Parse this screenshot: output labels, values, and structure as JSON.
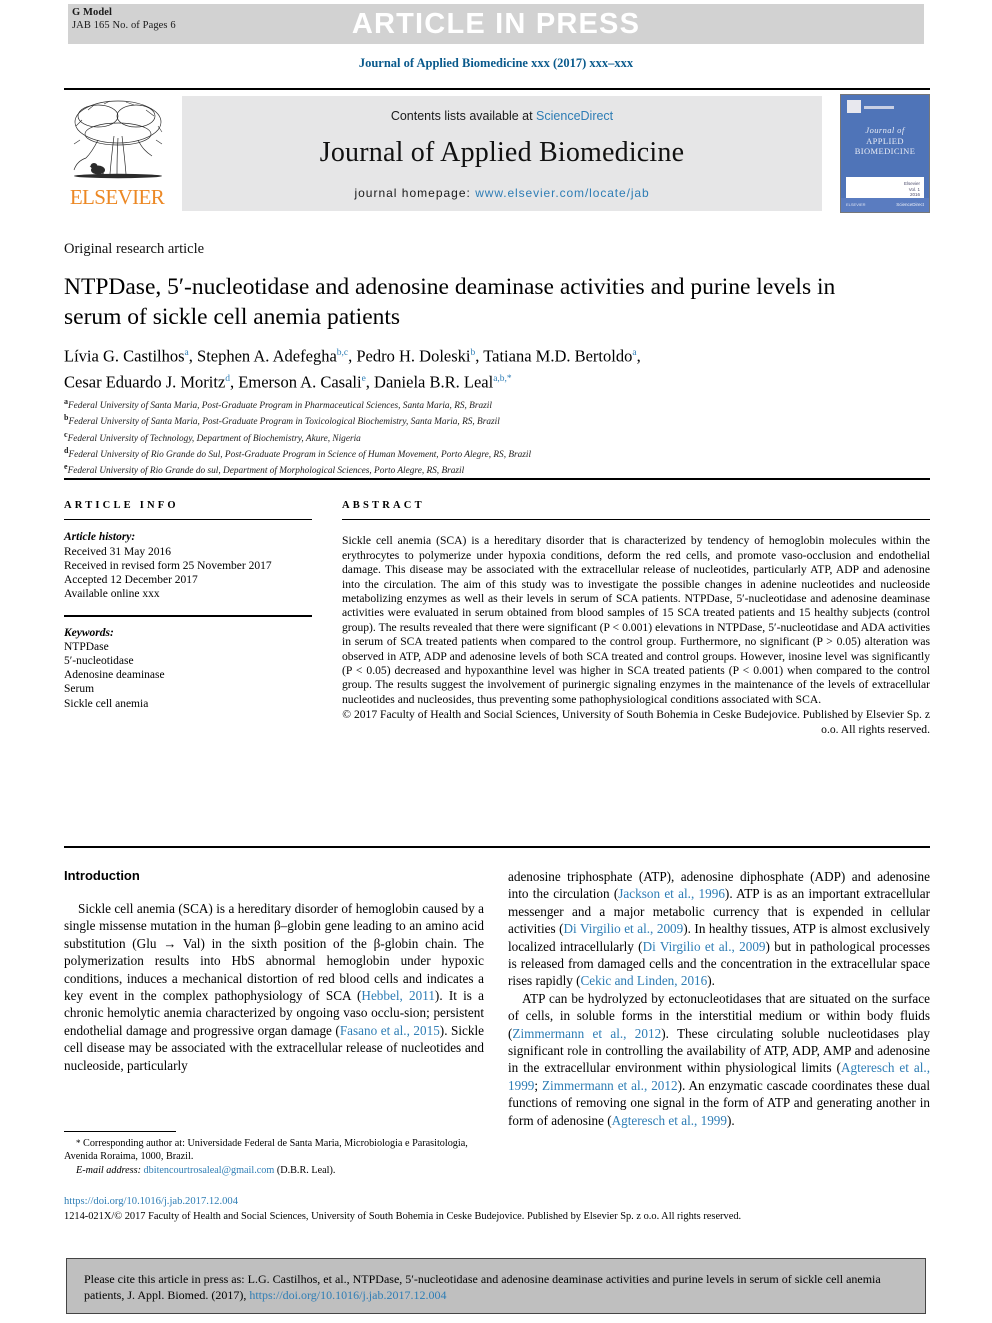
{
  "banner": {
    "g_model": "G Model",
    "jab_line": "JAB 165 No. of Pages 6",
    "press_text": "ARTICLE IN PRESS"
  },
  "journal_line": "Journal of Applied Biomedicine xxx (2017) xxx–xxx",
  "masthead": {
    "publisher": "ELSEVIER",
    "contents_prefix": "Contents lists available at ",
    "contents_link": "ScienceDirect",
    "journal_title": "Journal of Applied Biomedicine",
    "homepage_label": "journal homepage: ",
    "homepage_url": "www.elsevier.com/locate/jab",
    "cover": {
      "line1": "Journal of",
      "line2": "APPLIED",
      "line3": "BIOMEDICINE",
      "corner_lines": "Elsevier\nVol. 1\n2016",
      "footer_left": "ELSEVIER",
      "footer_right": "ScienceDirect"
    }
  },
  "article": {
    "type": "Original research article",
    "title": "NTPDase, 5′-nucleotidase and adenosine deaminase activities and purine levels in serum of sickle cell anemia patients",
    "authors_line1": "Lívia G. Castilhos",
    "authors": [
      {
        "name": "Lívia G. Castilhos",
        "sup": "a"
      },
      {
        "name": "Stephen A. Adefegha",
        "sup": "b,c"
      },
      {
        "name": "Pedro H. Doleski",
        "sup": "b"
      },
      {
        "name": "Tatiana M.D. Bertoldo",
        "sup": "a"
      },
      {
        "name": "Cesar Eduardo J. Moritz",
        "sup": "d"
      },
      {
        "name": "Emerson A. Casali",
        "sup": "e"
      },
      {
        "name": "Daniela B.R. Leal",
        "sup": "a,b,*"
      }
    ],
    "affiliations": [
      {
        "mark": "a",
        "text": "Federal University of Santa Maria, Post-Graduate Program in Pharmaceutical Sciences, Santa Maria, RS, Brazil"
      },
      {
        "mark": "b",
        "text": "Federal University of Santa Maria, Post-Graduate Program in Toxicological Biochemistry, Santa Maria, RS, Brazil"
      },
      {
        "mark": "c",
        "text": "Federal University of Technology, Department of Biochemistry, Akure, Nigeria"
      },
      {
        "mark": "d",
        "text": "Federal University of Rio Grande do Sul, Post-Graduate Program in Science of Human Movement, Porto Alegre, RS, Brazil"
      },
      {
        "mark": "e",
        "text": "Federal University of Rio Grande do sul, Department of Morphological Sciences, Porto Alegre, RS, Brazil"
      }
    ]
  },
  "article_info": {
    "heading": "ARTICLE INFO",
    "history_label": "Article history:",
    "history": [
      "Received 31 May 2016",
      "Received in revised form 25 November 2017",
      "Accepted 12 December 2017",
      "Available online xxx"
    ],
    "keywords_label": "Keywords:",
    "keywords": [
      "NTPDase",
      "5′-nucleotidase",
      "Adenosine deaminase",
      "Serum",
      "Sickle cell anemia"
    ]
  },
  "abstract": {
    "heading": "ABSTRACT",
    "body": "Sickle cell anemia (SCA) is a hereditary disorder that is characterized by tendency of hemoglobin molecules within the erythrocytes to polymerize under hypoxia conditions, deform the red cells, and promote vaso-occlusion and endothelial damage. This disease may be associated with the extracellular release of nucleotides, particularly ATP, ADP and adenosine into the circulation. The aim of this study was to investigate the possible changes in adenine nucleotides and nucleoside metabolizing enzymes as well as their levels in serum of SCA patients. NTPDase, 5′-nucleotidase and adenosine deaminase activities were evaluated in serum obtained from blood samples of 15 SCA treated patients and 15 healthy subjects (control group). The results revealed that there were significant (P < 0.001) elevations in NTPDase, 5′-nucleotidase and ADA activities in serum of SCA treated patients when compared to the control group. Furthermore, no significant (P > 0.05) alteration was observed in ATP, ADP and adenosine levels of both SCA treated and control groups. However, inosine level was significantly (P < 0.05) decreased and hypoxanthine level was higher in SCA treated patients (P < 0.001) when compared to the control group. The results suggest the involvement of purinergic signaling enzymes in the maintenance of the levels of extracellular nucleotides and nucleosides, thus preventing some pathophysiological conditions associated with SCA.",
    "copyright": "© 2017 Faculty of Health and Social Sciences, University of South Bohemia in Ceske Budejovice. Published by Elsevier Sp. z o.o. All rights reserved."
  },
  "introduction": {
    "heading": "Introduction",
    "left_para1_a": "Sickle cell anemia (SCA) is a hereditary disorder of hemoglobin caused by a single missense mutation in the human β–globin gene leading to an amino acid substitution (Glu → Val) in the sixth position of the β-globin chain. The polymerization results into HbS abnormal hemoglobin under hypoxic conditions, induces a mechanical distortion of red blood cells and indicates a key event in the complex pathophysiology of SCA (",
    "left_ref1": "Hebbel, 2011",
    "left_para1_b": "). It is a chronic hemolytic anemia characterized by ongoing vaso occlu-sion; persistent endothelial damage and progressive organ damage (",
    "left_ref2": "Fasano et al., 2015",
    "left_para1_c": "). Sickle cell disease may be associated with the extracellular release of nucleotides and nucleoside, particularly",
    "right_para1_a": "adenosine triphosphate (ATP), adenosine diphosphate (ADP) and adenosine into the circulation (",
    "right_ref1": "Jackson et al., 1996",
    "right_para1_b": "). ATP is as an important extracellular messenger and a major metabolic currency that is expended in cellular activities (",
    "right_ref2": "Di Virgilio et al., 2009",
    "right_para1_c": "). In healthy tissues, ATP is almost exclusively localized intracellularly (",
    "right_ref3": "Di Virgilio et al., 2009",
    "right_para1_d": ") but in pathological processes is released from damaged cells and the concentration in the extracellular space rises rapidly (",
    "right_ref4": "Cekic and Linden, 2016",
    "right_para1_e": ").",
    "right_para2_a": "ATP can be hydrolyzed by ectonucleotidases that are situated on the surface of cells, in soluble forms in the interstitial medium or within body fluids (",
    "right_ref5": "Zimmermann et al., 2012",
    "right_para2_b": "). These circulating soluble nucleotidases play significant role in controlling the availability of ATP, ADP, AMP and adenosine in the extracellular environment within physiological limits (",
    "right_ref6": "Agteresch et al., 1999",
    "right_para2_c": "; ",
    "right_ref7": "Zimmermann et al., 2012",
    "right_para2_d": "). An enzymatic cascade coordinates these dual functions of removing one signal in the form of ATP and generating another in form of adenosine (",
    "right_ref8": "Agteresch et al., 1999",
    "right_para2_e": ")."
  },
  "footnotes": {
    "corresponding_star": "*",
    "corresponding": "Corresponding author at: Universidade Federal de Santa Maria, Microbiologia e Parasitologia, Avenida Roraima, 1000, Brazil.",
    "email_label": "E-mail address:",
    "email": "dbitencourtrosaleal@gmail.com",
    "email_owner": "(D.B.R. Leal).",
    "doi": "https://doi.org/10.1016/j.jab.2017.12.004",
    "issn_line": "1214-021X/© 2017 Faculty of Health and Social Sciences, University of South Bohemia in Ceske Budejovice. Published by Elsevier Sp. z o.o. All rights reserved."
  },
  "cite_box": {
    "text_a": "Please cite this article in press as: L.G. Castilhos, et al., NTPDase, 5′-nucleotidase and adenosine deaminase activities and purine levels in serum of sickle cell anemia patients, J. Appl. Biomed. (2017), ",
    "link": "https://doi.org/10.1016/j.jab.2017.12.004"
  },
  "colors": {
    "link_blue": "#2e7db5",
    "journal_blue": "#0a5a8c",
    "elsevier_orange": "#ec8824",
    "banner_gray": "#d2d2d2",
    "band_gray": "#e6e6e7",
    "cite_gray": "#bfbfbf",
    "cover_blue": "#4f74b8"
  }
}
